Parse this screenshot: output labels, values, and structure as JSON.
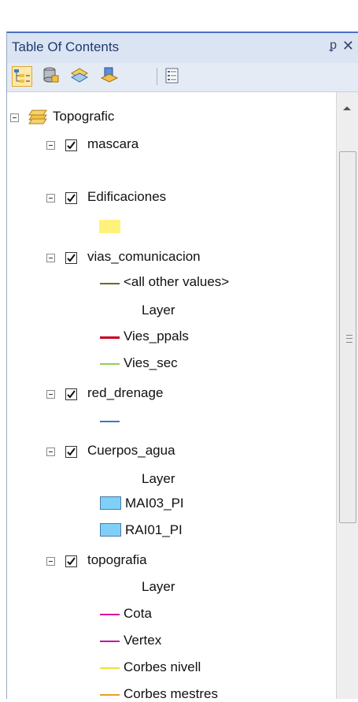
{
  "window": {
    "title": "Table Of Contents",
    "pin_glyph": "ᵱ",
    "close_glyph": "✕"
  },
  "toolbar": {
    "buttons": [
      {
        "name": "list-by-drawing-order-icon",
        "selected": true
      },
      {
        "name": "list-by-source-icon"
      },
      {
        "name": "list-by-visibility-icon"
      },
      {
        "name": "list-by-selection-icon"
      },
      {
        "name": "options-icon"
      }
    ]
  },
  "tree": {
    "root": {
      "label": "Topografic"
    },
    "layers": [
      {
        "label": "mascara",
        "checked": true
      },
      {
        "label": "Edificaciones",
        "checked": true,
        "legend": [
          {
            "type": "fill",
            "color": "#fff27a",
            "label": ""
          }
        ]
      },
      {
        "label": "vias_comunicacion",
        "checked": true,
        "legend": [
          {
            "type": "line",
            "color": "#6b6b1f",
            "label": "<all other values>"
          },
          {
            "type": "heading",
            "label": "Layer"
          },
          {
            "type": "line",
            "color": "#c8001e",
            "label": "Vies_ppals"
          },
          {
            "type": "line",
            "color": "#8fd14f",
            "label": "Vies_sec"
          }
        ]
      },
      {
        "label": "red_drenage",
        "checked": true,
        "legend": [
          {
            "type": "line",
            "color": "#3a78c0",
            "label": ""
          }
        ]
      },
      {
        "label": "Cuerpos_agua",
        "checked": true,
        "legend": [
          {
            "type": "heading",
            "label": "Layer"
          },
          {
            "type": "fill",
            "color": "#7fd0f7",
            "label": "MAI03_PI"
          },
          {
            "type": "fill",
            "color": "#7fd0f7",
            "label": "RAI01_PI"
          }
        ]
      },
      {
        "label": "topografia",
        "checked": true,
        "legend": [
          {
            "type": "heading",
            "label": "Layer"
          },
          {
            "type": "line",
            "color": "#d4149a",
            "label": "Cota"
          },
          {
            "type": "line",
            "color": "#c8149b",
            "label": "Vertex"
          },
          {
            "type": "line",
            "color": "#f2e03a",
            "label": "Corbes nivell"
          },
          {
            "type": "line",
            "color": "#e8a020",
            "label": "Corbes mestres"
          }
        ]
      }
    ]
  },
  "colors": {
    "accent": "#4a70c8",
    "titlebar_bg": "#dbe4f3",
    "title_text": "#1e3b6e"
  }
}
